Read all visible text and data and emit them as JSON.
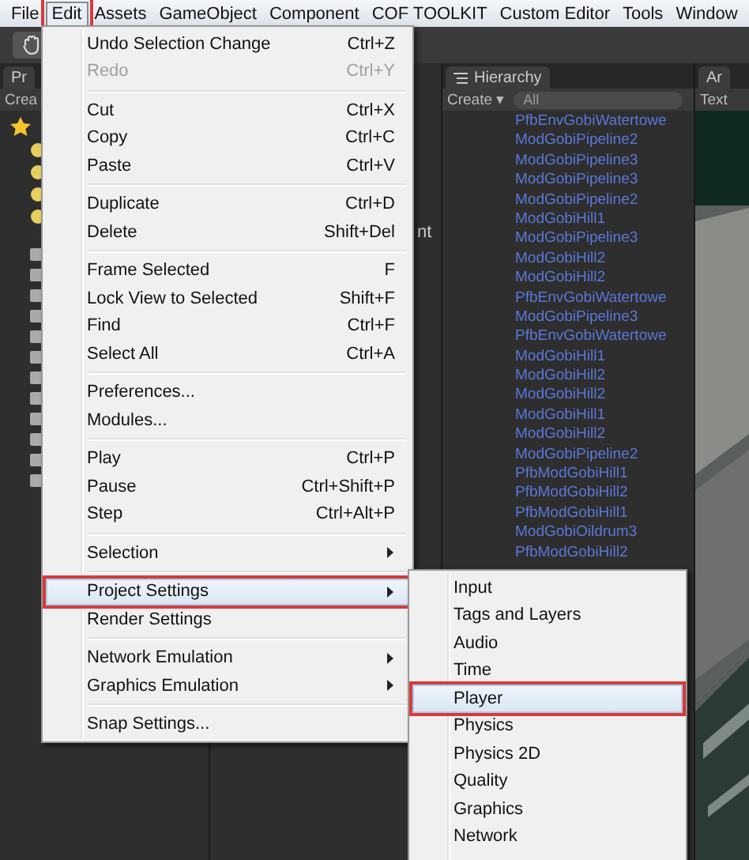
{
  "menubar": [
    {
      "label": "File",
      "selected": false
    },
    {
      "label": "Edit",
      "selected": true
    },
    {
      "label": "Assets",
      "selected": false
    },
    {
      "label": "GameObject",
      "selected": false
    },
    {
      "label": "Component",
      "selected": false
    },
    {
      "label": "COF TOOLKIT",
      "selected": false
    },
    {
      "label": "Custom Editor",
      "selected": false
    },
    {
      "label": "Tools",
      "selected": false
    },
    {
      "label": "Window",
      "selected": false
    }
  ],
  "project_panel": {
    "tab": "Pr",
    "create": "Crea"
  },
  "inspector_panel": {
    "text": "nt"
  },
  "hierarchy": {
    "title": "Hierarchy",
    "create": "Create ▾",
    "search": {
      "placeholder": "All"
    },
    "items": [
      "PfbEnvGobiWatertowe",
      "ModGobiPipeline2",
      "ModGobiPipeline3",
      "ModGobiPipeline3",
      "ModGobiPipeline2",
      "ModGobiHill1",
      "ModGobiPipeline3",
      "ModGobiHill2",
      "ModGobiHill2",
      "PfbEnvGobiWatertowe",
      "ModGobiPipeline3",
      "PfbEnvGobiWatertowe",
      "ModGobiHill1",
      "ModGobiHill2",
      "ModGobiHill2",
      "ModGobiHill1",
      "ModGobiHill2",
      "ModGobiPipeline2",
      "PfbModGobiHill1",
      "PfbModGobiHill2",
      "PfbModGobiHill1",
      "ModGobiOildrum3",
      "PfbModGobiHill2"
    ]
  },
  "scene_panel": {
    "tab": "Ar",
    "button": "Text",
    "kind": "picture"
  },
  "edit_menu": {
    "items": [
      {
        "kind": "item",
        "label": "Undo Selection Change",
        "shortcut": "Ctrl+Z",
        "disabled": false,
        "submenu": false,
        "selected": false
      },
      {
        "kind": "item",
        "label": "Redo",
        "shortcut": "Ctrl+Y",
        "disabled": true,
        "submenu": false,
        "selected": false
      },
      {
        "kind": "separator"
      },
      {
        "kind": "item",
        "label": "Cut",
        "shortcut": "Ctrl+X",
        "disabled": false,
        "submenu": false,
        "selected": false
      },
      {
        "kind": "item",
        "label": "Copy",
        "shortcut": "Ctrl+C",
        "disabled": false,
        "submenu": false,
        "selected": false
      },
      {
        "kind": "item",
        "label": "Paste",
        "shortcut": "Ctrl+V",
        "disabled": false,
        "submenu": false,
        "selected": false
      },
      {
        "kind": "separator"
      },
      {
        "kind": "item",
        "label": "Duplicate",
        "shortcut": "Ctrl+D",
        "disabled": false,
        "submenu": false,
        "selected": false
      },
      {
        "kind": "item",
        "label": "Delete",
        "shortcut": "Shift+Del",
        "disabled": false,
        "submenu": false,
        "selected": false
      },
      {
        "kind": "separator"
      },
      {
        "kind": "item",
        "label": "Frame Selected",
        "shortcut": "F",
        "disabled": false,
        "submenu": false,
        "selected": false
      },
      {
        "kind": "item",
        "label": "Lock View to Selected",
        "shortcut": "Shift+F",
        "disabled": false,
        "submenu": false,
        "selected": false
      },
      {
        "kind": "item",
        "label": "Find",
        "shortcut": "Ctrl+F",
        "disabled": false,
        "submenu": false,
        "selected": false
      },
      {
        "kind": "item",
        "label": "Select All",
        "shortcut": "Ctrl+A",
        "disabled": false,
        "submenu": false,
        "selected": false
      },
      {
        "kind": "separator"
      },
      {
        "kind": "item",
        "label": "Preferences...",
        "disabled": false,
        "submenu": false,
        "selected": false
      },
      {
        "kind": "item",
        "label": "Modules...",
        "disabled": false,
        "submenu": false,
        "selected": false
      },
      {
        "kind": "separator"
      },
      {
        "kind": "item",
        "label": "Play",
        "shortcut": "Ctrl+P",
        "disabled": false,
        "submenu": false,
        "selected": false
      },
      {
        "kind": "item",
        "label": "Pause",
        "shortcut": "Ctrl+Shift+P",
        "disabled": false,
        "submenu": false,
        "selected": false
      },
      {
        "kind": "item",
        "label": "Step",
        "shortcut": "Ctrl+Alt+P",
        "disabled": false,
        "submenu": false,
        "selected": false
      },
      {
        "kind": "separator"
      },
      {
        "kind": "item",
        "label": "Selection",
        "disabled": false,
        "submenu": true,
        "selected": false
      },
      {
        "kind": "separator"
      },
      {
        "kind": "item",
        "label": "Project Settings",
        "disabled": false,
        "submenu": true,
        "selected": true
      },
      {
        "kind": "item",
        "label": "Render Settings",
        "disabled": false,
        "submenu": false,
        "selected": false
      },
      {
        "kind": "separator"
      },
      {
        "kind": "item",
        "label": "Network Emulation",
        "disabled": false,
        "submenu": true,
        "selected": false
      },
      {
        "kind": "item",
        "label": "Graphics Emulation",
        "disabled": false,
        "submenu": true,
        "selected": false
      },
      {
        "kind": "separator"
      },
      {
        "kind": "item",
        "label": "Snap Settings...",
        "disabled": false,
        "submenu": false,
        "selected": false
      }
    ]
  },
  "project_settings_menu": {
    "items": [
      {
        "label": "Input",
        "selected": false
      },
      {
        "label": "Tags and Layers",
        "selected": false
      },
      {
        "label": "Audio",
        "selected": false
      },
      {
        "label": "Time",
        "selected": false
      },
      {
        "label": "Player",
        "selected": true
      },
      {
        "label": "Physics",
        "selected": false
      },
      {
        "label": "Physics 2D",
        "selected": false
      },
      {
        "label": "Quality",
        "selected": false
      },
      {
        "label": "Graphics",
        "selected": false
      },
      {
        "label": "Network",
        "selected": false
      }
    ]
  }
}
